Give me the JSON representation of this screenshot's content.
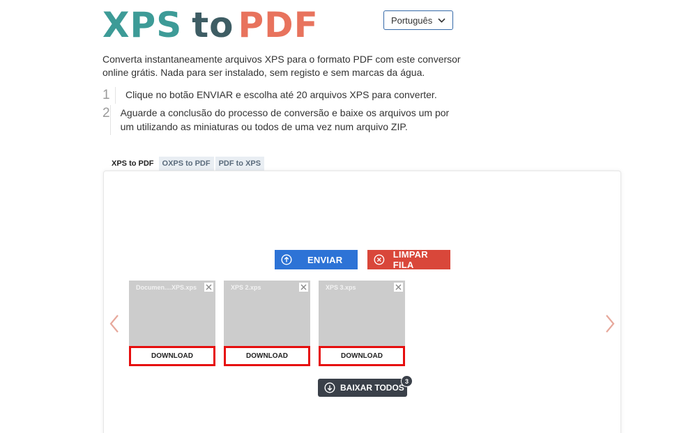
{
  "logo": {
    "part1": "XPS",
    "part2": "to",
    "part3": "PDF"
  },
  "language": {
    "selected": "Português"
  },
  "intro": "Converta instantaneamente arquivos XPS para o formato PDF com este conversor online grátis. Nada para ser instalado, sem registo e sem marcas da água.",
  "steps": [
    {
      "num": "1",
      "text": "Clique no botão ENVIAR e escolha até 20 arquivos XPS para converter."
    },
    {
      "num": "2",
      "text": "Aguarde a conclusão do processo de conversão e baixe os arquivos um por um utilizando as miniaturas ou todos de uma vez num arquivo ZIP."
    }
  ],
  "tabs": [
    {
      "label": "XPS to PDF",
      "active": true
    },
    {
      "label": "OXPS to PDF",
      "active": false
    },
    {
      "label": "PDF to XPS",
      "active": false
    }
  ],
  "buttons": {
    "upload": "ENVIAR",
    "clear": "LIMPAR FILA",
    "download_all": "BAIXAR TODOS"
  },
  "files": [
    {
      "name": "Documen....XPS.xps",
      "download": "DOWNLOAD"
    },
    {
      "name": "XPS 2.xps",
      "download": "DOWNLOAD"
    },
    {
      "name": "XPS 3.xps",
      "download": "DOWNLOAD"
    }
  ],
  "badge_count": "3",
  "colors": {
    "logo_teal": "#3d9b97",
    "logo_dark": "#3e5d64",
    "logo_coral": "#e8735d",
    "upload_blue": "#2d73d6",
    "clear_red": "#d9473a",
    "highlight_red": "#e60e0e",
    "dark_button": "#3a4049"
  },
  "icons": {
    "upload": "arrow-up-circle-icon",
    "clear": "x-circle-icon",
    "download_all": "arrow-down-circle-icon",
    "close": "close-icon",
    "nav_prev": "chevron-left-icon",
    "nav_next": "chevron-right-icon",
    "dropdown": "chevron-down-icon"
  }
}
